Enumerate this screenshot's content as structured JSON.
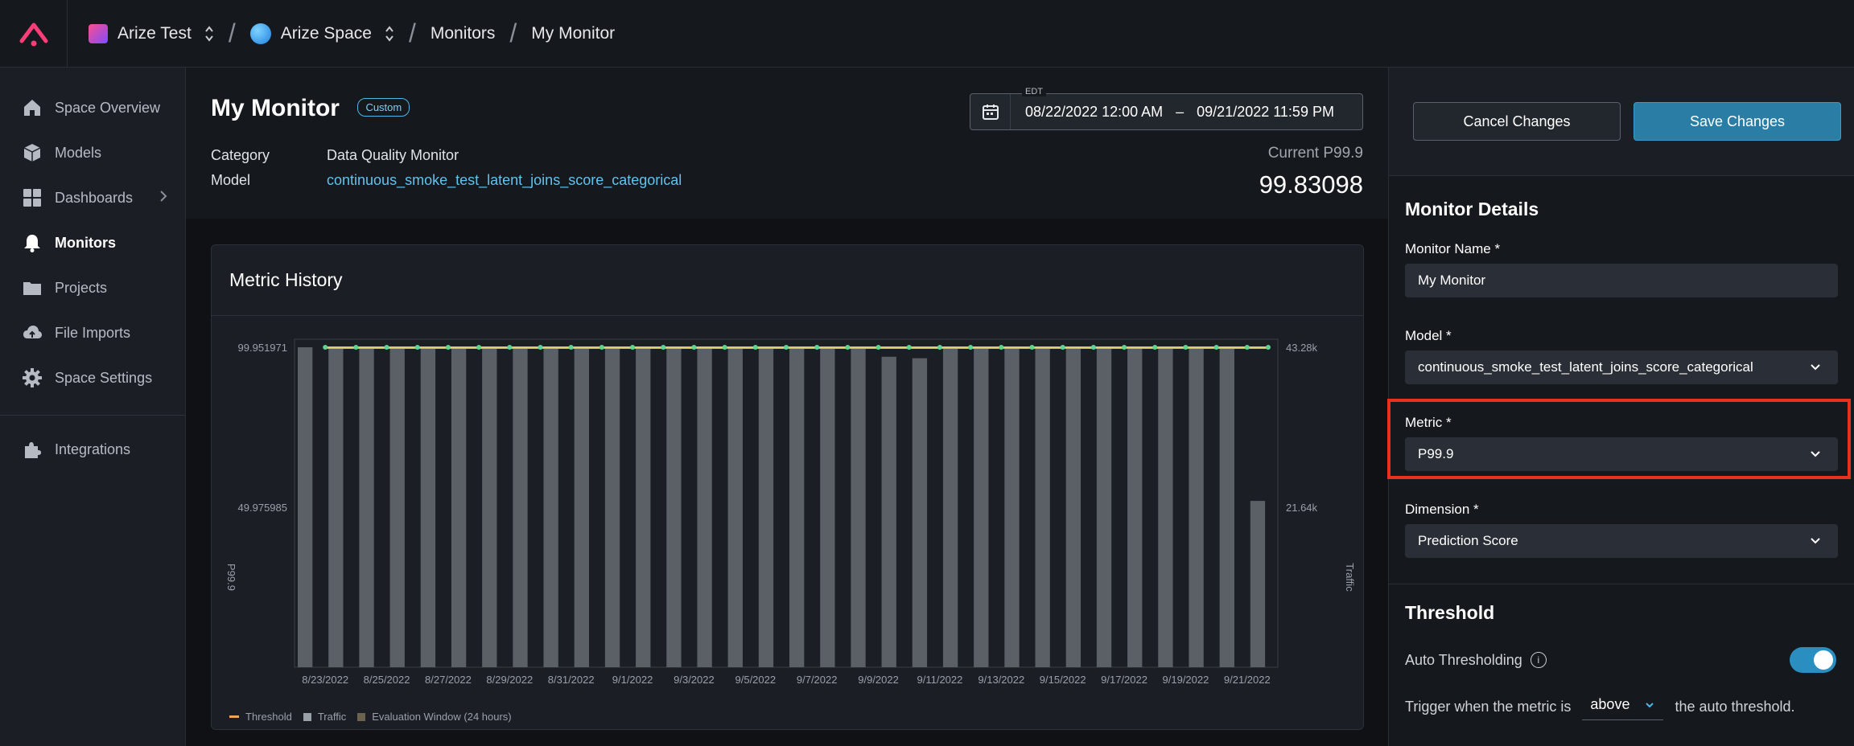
{
  "topbar": {
    "breadcrumbs": [
      "Arize Test",
      "Arize Space",
      "Monitors",
      "My Monitor"
    ]
  },
  "sidebar": {
    "items": [
      {
        "label": "Space Overview",
        "icon": "home-icon"
      },
      {
        "label": "Models",
        "icon": "cube-icon"
      },
      {
        "label": "Dashboards",
        "icon": "grid-icon"
      },
      {
        "label": "Monitors",
        "icon": "bell-icon"
      },
      {
        "label": "Projects",
        "icon": "folder-icon"
      },
      {
        "label": "File Imports",
        "icon": "cloud-upload-icon"
      },
      {
        "label": "Space Settings",
        "icon": "gear-icon"
      },
      {
        "label": "Integrations",
        "icon": "puzzle-icon"
      }
    ]
  },
  "header": {
    "title": "My Monitor",
    "badge": "Custom",
    "category_label": "Category",
    "category_value": "Data Quality Monitor",
    "model_label": "Model",
    "model_value": "continuous_smoke_test_latent_joins_score_categorical",
    "date_tz": "EDT",
    "date_start": "08/22/2022 12:00 AM",
    "date_sep": "–",
    "date_end": "09/21/2022 11:59 PM",
    "current_label": "Current P99.9",
    "current_value": "99.83098"
  },
  "card": {
    "title": "Metric History",
    "legend": [
      "Threshold",
      "Traffic",
      "Evaluation Window (24 hours)"
    ]
  },
  "chart_data": {
    "type": "bar",
    "ylabel": "P99.9",
    "y2label": "Traffic",
    "yticks": [
      "99.951971",
      "49.975985"
    ],
    "y2ticks": [
      "43.28k",
      "21.64k"
    ],
    "xticks": [
      "8/23/2022",
      "8/25/2022",
      "8/27/2022",
      "8/29/2022",
      "8/31/2022",
      "9/1/2022",
      "9/3/2022",
      "9/5/2022",
      "9/7/2022",
      "9/9/2022",
      "9/11/2022",
      "9/13/2022",
      "9/15/2022",
      "9/17/2022",
      "9/19/2022",
      "9/21/2022"
    ],
    "traffic": [
      43280,
      43280,
      43280,
      43280,
      43280,
      43280,
      43280,
      43280,
      43280,
      43280,
      43280,
      43280,
      43280,
      43280,
      43280,
      43280,
      43280,
      43280,
      43280,
      42000,
      41800,
      43280,
      43280,
      43280,
      43280,
      43280,
      43280,
      43280,
      43280,
      43280,
      43280,
      22500
    ],
    "metric_value": 99.951971,
    "traffic_max": 43280,
    "colors": {
      "metric_line": "#d9d46a",
      "threshold": "#f0a35c",
      "points": "#5fd38f",
      "traffic": "#5b5f66"
    }
  },
  "panel": {
    "cancel_label": "Cancel Changes",
    "save_label": "Save Changes",
    "details_title": "Monitor Details",
    "name_label": "Monitor Name *",
    "name_value": "My Monitor",
    "model_label": "Model *",
    "model_value": "continuous_smoke_test_latent_joins_score_categorical",
    "metric_label": "Metric *",
    "metric_value": "P99.9",
    "dimension_label": "Dimension *",
    "dimension_value": "Prediction Score",
    "threshold_title": "Threshold",
    "auto_label": "Auto Thresholding",
    "auto_enabled": true,
    "trigger_prefix": "Trigger when the metric is",
    "trigger_value": "above",
    "trigger_suffix": "the auto threshold."
  }
}
